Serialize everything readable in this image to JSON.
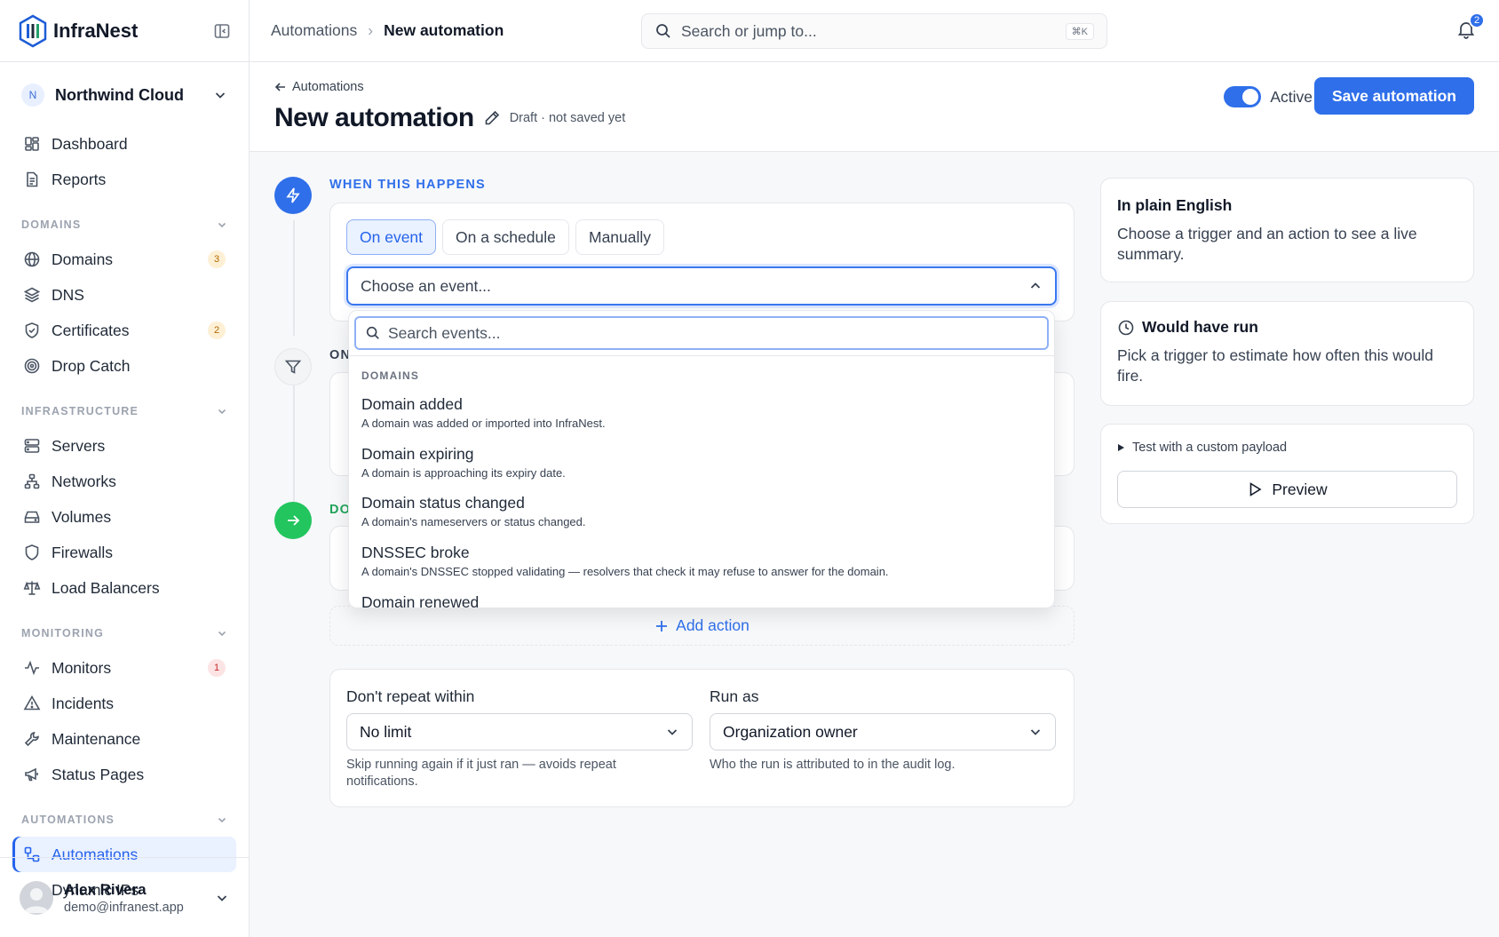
{
  "app": {
    "name": "InfraNest"
  },
  "org": {
    "initial": "N",
    "name": "Northwind Cloud"
  },
  "nav": {
    "dashboard": "Dashboard",
    "reports": "Reports",
    "domains_section": "DOMAINS",
    "domains": "Domains",
    "domains_count": "3",
    "dns": "DNS",
    "certificates": "Certificates",
    "certificates_count": "2",
    "drop_catch": "Drop Catch",
    "infra_section": "INFRASTRUCTURE",
    "servers": "Servers",
    "networks": "Networks",
    "volumes": "Volumes",
    "firewalls": "Firewalls",
    "load_balancers": "Load Balancers",
    "monitoring_section": "MONITORING",
    "monitors": "Monitors",
    "monitors_count": "1",
    "incidents": "Incidents",
    "maintenance": "Maintenance",
    "status_pages": "Status Pages",
    "automations_section": "AUTOMATIONS",
    "automations": "Automations",
    "dynamic_ips": "Dynamic IPs"
  },
  "user": {
    "name": "Alex Rivera",
    "email": "demo@infranest.app"
  },
  "topbar": {
    "crumb_parent": "Automations",
    "crumb_sep": "›",
    "crumb_current": "New automation",
    "search_placeholder": "Search or jump to...",
    "search_shortcut": "⌘K",
    "notifications_count": "2"
  },
  "header": {
    "back_label": "Automations",
    "title": "New automation",
    "draft_status": "Draft · not saved yet",
    "active_label": "Active",
    "active": true,
    "save_label": "Save automation"
  },
  "trigger": {
    "section_label": "WHEN THIS HAPPENS",
    "tabs": [
      "On event",
      "On a schedule",
      "Manually"
    ],
    "selected_tab": "On event",
    "select_placeholder": "Choose an event...",
    "dropdown": {
      "search_placeholder": "Search events...",
      "group": "DOMAINS",
      "items": [
        {
          "title": "Domain added",
          "desc": "A domain was added or imported into InfraNest."
        },
        {
          "title": "Domain expiring",
          "desc": "A domain is approaching its expiry date."
        },
        {
          "title": "Domain status changed",
          "desc": "A domain's nameservers or status changed."
        },
        {
          "title": "DNSSEC broke",
          "desc": "A domain's DNSSEC stopped validating — resolvers that check it may refuse to answer for the domain."
        },
        {
          "title": "Domain renewed",
          "desc": ""
        }
      ]
    }
  },
  "filter": {
    "section_label": "ON"
  },
  "action": {
    "section_label": "DO",
    "add_label": "Add action"
  },
  "options": {
    "repeat_label": "Don't repeat within",
    "repeat_value": "No limit",
    "repeat_help": "Skip running again if it just ran — avoids repeat notifications.",
    "runas_label": "Run as",
    "runas_value": "Organization owner",
    "runas_help": "Who the run is attributed to in the audit log."
  },
  "summary": {
    "title": "In plain English",
    "body": "Choose a trigger and an action to see a live summary."
  },
  "would_run": {
    "title": "Would have run",
    "body": "Pick a trigger to estimate how often this would fire."
  },
  "test": {
    "label": "Test with a custom payload",
    "preview_label": "Preview"
  },
  "colors": {
    "accent": "#2f6fea",
    "success": "#22c55e"
  }
}
